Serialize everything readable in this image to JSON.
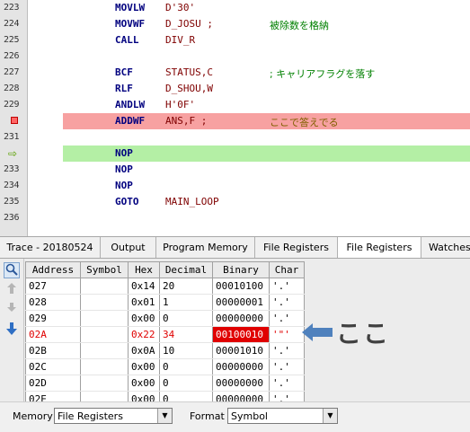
{
  "editor": {
    "lines": [
      {
        "num": "223",
        "op": "MOVLW",
        "arg": "D'30'",
        "comment": "",
        "mark": ""
      },
      {
        "num": "224",
        "op": "MOVWF",
        "arg": "D_JOSU  ;",
        "comment": "被除数を格納",
        "mark": ""
      },
      {
        "num": "225",
        "op": "CALL",
        "arg": "DIV_R",
        "comment": "",
        "mark": ""
      },
      {
        "num": "226",
        "op": "",
        "arg": "",
        "comment": "",
        "mark": ""
      },
      {
        "num": "227",
        "op": "BCF",
        "arg": "STATUS,C",
        "comment": ";        キャリアフラグを落す",
        "mark": ""
      },
      {
        "num": "228",
        "op": "RLF",
        "arg": "D_SHOU,W",
        "comment": "",
        "mark": ""
      },
      {
        "num": "229",
        "op": "ANDLW",
        "arg": "H'0F'",
        "comment": "",
        "mark": ""
      },
      {
        "num": "",
        "op": "ADDWF",
        "arg": "ANS,F   ;",
        "comment": "ここで答えでる",
        "mark": "breakpoint"
      },
      {
        "num": "231",
        "op": "",
        "arg": "",
        "comment": "",
        "mark": ""
      },
      {
        "num": "",
        "op": "NOP",
        "arg": "",
        "comment": "",
        "mark": "current"
      },
      {
        "num": "233",
        "op": "NOP",
        "arg": "",
        "comment": "",
        "mark": ""
      },
      {
        "num": "234",
        "op": "NOP",
        "arg": "",
        "comment": "",
        "mark": ""
      },
      {
        "num": "235",
        "op": "GOTO",
        "arg": "MAIN_LOOP",
        "comment": "",
        "mark": ""
      },
      {
        "num": "236",
        "op": "",
        "arg": "",
        "comment": "",
        "mark": ""
      }
    ]
  },
  "tabs": [
    "Trace - 20180524",
    "Output",
    "Program Memory",
    "File Registers",
    "File Registers",
    "Watches"
  ],
  "watch": {
    "columns": [
      "Address",
      "Symbol",
      "Hex",
      "Decimal",
      "Binary",
      "Char"
    ],
    "rows": [
      {
        "address": "027",
        "symbol": "",
        "hex": "0x14",
        "decimal": "20",
        "binary": "00010100",
        "char": "'.'"
      },
      {
        "address": "028",
        "symbol": "",
        "hex": "0x01",
        "decimal": "1",
        "binary": "00000001",
        "char": "'.'"
      },
      {
        "address": "029",
        "symbol": "",
        "hex": "0x00",
        "decimal": "0",
        "binary": "00000000",
        "char": "'.'"
      },
      {
        "address": "02A",
        "symbol": "",
        "hex": "0x22",
        "decimal": "34",
        "binary": "00100010",
        "char": "'\"'"
      },
      {
        "address": "02B",
        "symbol": "",
        "hex": "0x0A",
        "decimal": "10",
        "binary": "00001010",
        "char": "'.'"
      },
      {
        "address": "02C",
        "symbol": "",
        "hex": "0x00",
        "decimal": "0",
        "binary": "00000000",
        "char": "'.'"
      },
      {
        "address": "02D",
        "symbol": "",
        "hex": "0x00",
        "decimal": "0",
        "binary": "00000000",
        "char": "'.'"
      },
      {
        "address": "02E",
        "symbol": "",
        "hex": "0x00",
        "decimal": "0",
        "binary": "00000000",
        "char": "'.'"
      }
    ],
    "annotation": "ここ"
  },
  "bottom": {
    "memory_label": "Memory",
    "memory_value": "File Registers",
    "format_label": "Format",
    "format_value": "Symbol"
  },
  "colors": {
    "breakpoint_line": "#f7a1a1",
    "current_line": "#b4efa5",
    "changed_value": "#e00000",
    "annotation_arrow": "#4f81bd"
  }
}
